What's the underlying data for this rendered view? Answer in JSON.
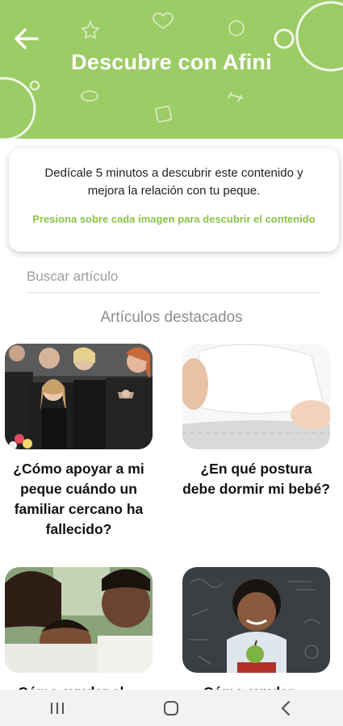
{
  "header": {
    "title": "Descubre con Afini",
    "back_icon": "arrow-left-icon",
    "background_color": "#9ccc65"
  },
  "info_card": {
    "main_text": "Dedícale 5 minutos a descubrir este contenido y mejora la relación con tu peque.",
    "hint_text": "Presiona sobre cada imagen para descubrir el contenido",
    "hint_color": "#8bc34a"
  },
  "search": {
    "placeholder": "Buscar artículo",
    "value": ""
  },
  "featured": {
    "title": "Artículos destacados",
    "articles": [
      {
        "title": "¿Cómo apoyar a mi peque cuándo un familiar cercano ha fallecido?",
        "image": "funeral-family-photo"
      },
      {
        "title": "¿En qué postura debe dormir mi bebé?",
        "image": "sleeping-baby-photo"
      },
      {
        "title": "Cómo ayudar al ...",
        "image": "family-hug-photo"
      },
      {
        "title": "Cómo ayudar ...",
        "image": "boy-chalkboard-photo"
      }
    ]
  },
  "navbar": {
    "recents_icon": "recent-apps-icon",
    "home_icon": "home-icon",
    "back_icon": "back-chevron-icon"
  }
}
